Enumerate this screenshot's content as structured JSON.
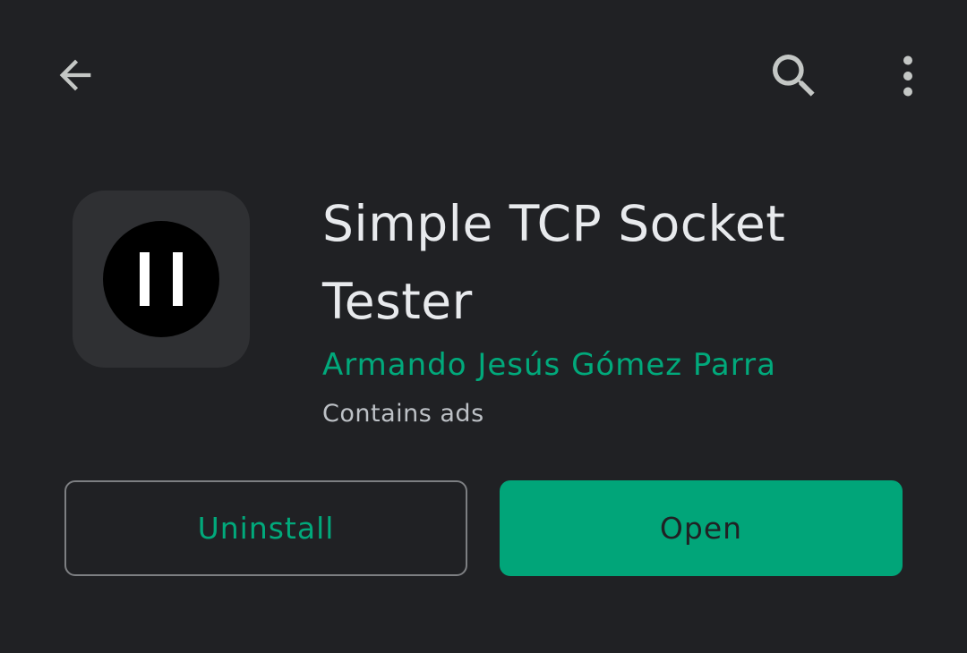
{
  "toolbar": {
    "back_icon": "arrow-back-icon",
    "search_icon": "search-icon",
    "more_icon": "more-vert-icon"
  },
  "app": {
    "icon": "pause-icon",
    "title": "Simple TCP Socket Tester",
    "developer": "Armando Jesús Gómez Parra",
    "ads_note": "Contains ads"
  },
  "actions": {
    "uninstall_label": "Uninstall",
    "open_label": "Open"
  },
  "colors": {
    "background": "#202124",
    "accent": "#01a97b",
    "open_button": "#01a579",
    "icon_tile": "#2f3033"
  }
}
